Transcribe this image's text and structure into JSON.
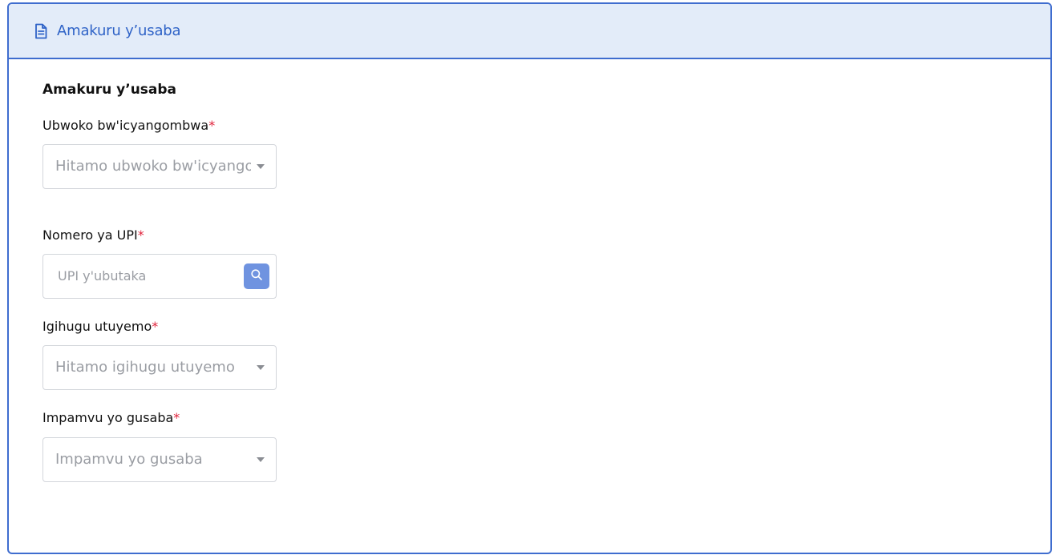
{
  "header": {
    "title": "Amakuru y’usaba",
    "icon": "document-icon"
  },
  "section": {
    "title": "Amakuru y’usaba"
  },
  "fields": {
    "land_type": {
      "label": "Ubwoko bw'icyangombwa",
      "required_mark": "*",
      "placeholder": "Hitamo ubwoko bw'icyangombwa"
    },
    "upi": {
      "label": "Nomero ya UPI",
      "required_mark": "*",
      "placeholder": "UPI y'ubutaka",
      "button_icon": "search-icon"
    },
    "country": {
      "label": "Igihugu utuyemo",
      "required_mark": "*",
      "placeholder": "Hitamo igihugu utuyemo"
    },
    "reason": {
      "label": "Impamvu yo gusaba",
      "required_mark": "*",
      "placeholder": "Impamvu yo gusaba"
    }
  },
  "colors": {
    "accent": "#3f6dcf",
    "header_bg": "#e3ecf9",
    "required": "#e0213a",
    "search_button": "#6f93e0"
  }
}
